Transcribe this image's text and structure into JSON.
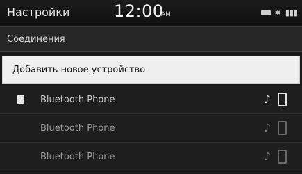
{
  "statusbar": {
    "title": "Настройки",
    "time": "12:00",
    "ampm": "AM",
    "icons": [
      "battery-icon",
      "bluetooth-icon",
      "signal-icon"
    ]
  },
  "section": {
    "label": "Соединения"
  },
  "actions": {
    "add_device": "Добавить новое устройство"
  },
  "devices": [
    {
      "name": "Bluetooth Phone",
      "connected": true,
      "icons": [
        "music-icon",
        "phone-icon"
      ]
    },
    {
      "name": "Bluetooth Phone",
      "connected": false,
      "icons": [
        "music-icon",
        "phone-icon"
      ]
    },
    {
      "name": "Bluetooth Phone",
      "connected": false,
      "icons": [
        "music-icon",
        "phone-icon"
      ]
    }
  ]
}
